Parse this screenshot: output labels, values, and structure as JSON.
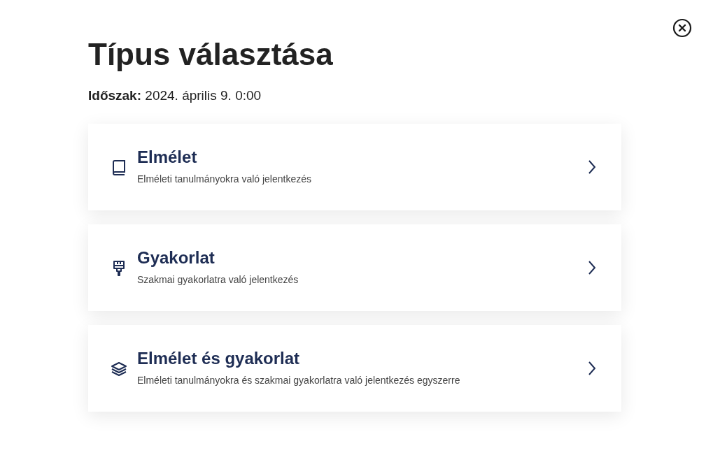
{
  "title": "Típus választása",
  "period": "**Időszak:** 2024. április 9. 0:00",
  "options": [
    {
      "kind": "book",
      "title": "Elmélet",
      "description": "Elméleti tanulmányokra való jelentkezés"
    },
    {
      "kind": "brush",
      "title": "Gyakorlat",
      "description": "Szakmai gyakorlatra való jelentkezés"
    },
    {
      "kind": "layers",
      "title": "Elmélet és gyakorlat",
      "description": "Elméleti tanulmányokra és szakmai gyakorlatra való jelentkezés egyszerre"
    }
  ]
}
